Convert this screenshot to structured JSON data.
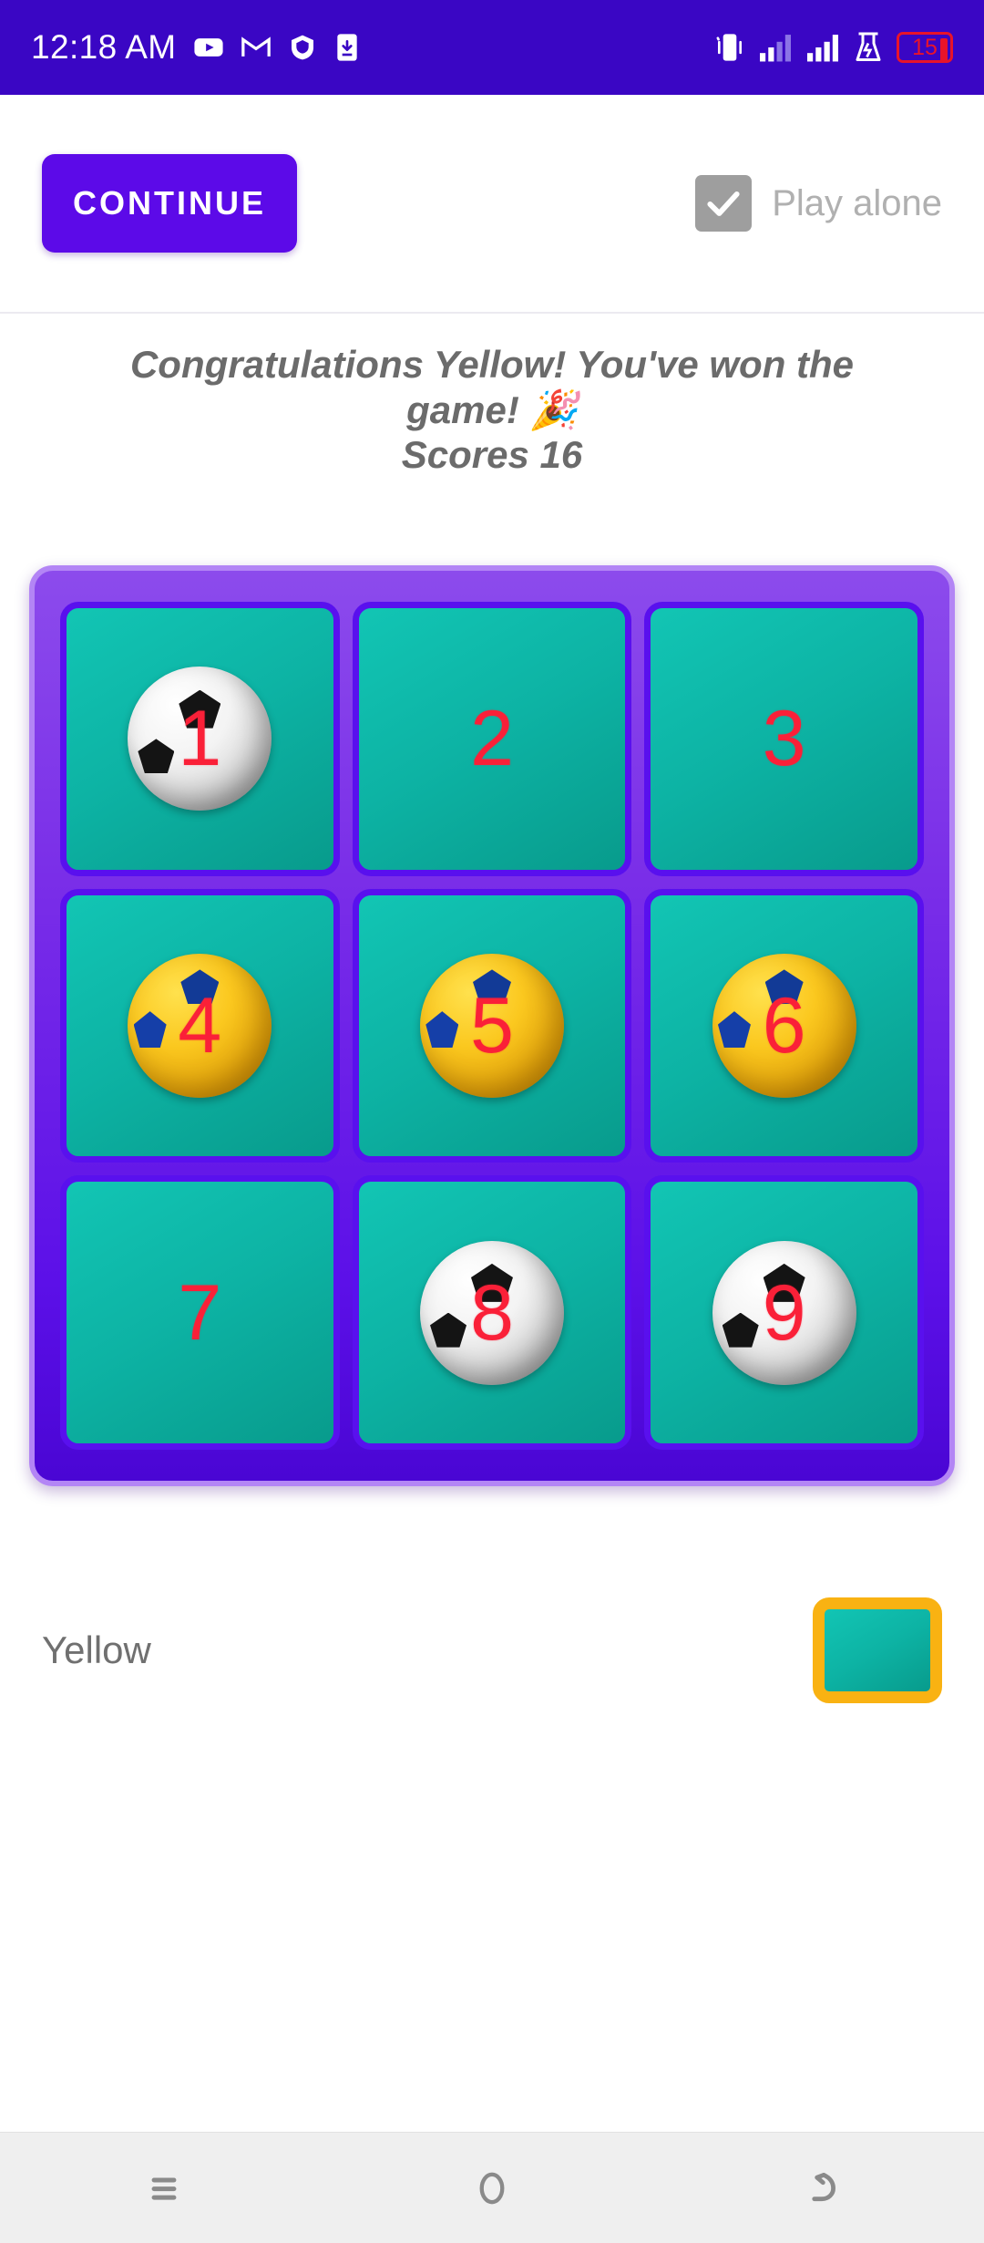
{
  "status_bar": {
    "time": "12:18 AM",
    "background_color": "#3a06c4",
    "left_icons": [
      "youtube-icon",
      "gmail-icon",
      "shield-icon",
      "download-icon"
    ],
    "right_icons": [
      "vibrate-icon",
      "signal-bars-1-icon",
      "signal-bars-2-icon",
      "alarm-flask-icon"
    ],
    "battery_level": "15",
    "battery_color": "#e8142a"
  },
  "toolbar": {
    "continue_label": "CONTINUE",
    "continue_color": "#5c0ae8",
    "play_alone_label": "Play alone",
    "play_alone_checked": true,
    "checkbox_color": "#9e9e9e"
  },
  "message": {
    "line1": "Congratulations Yellow! You've won the game! 🎉",
    "line2": "Scores 16",
    "score": 16,
    "winner": "Yellow",
    "text_color": "#6b6b6b"
  },
  "board": {
    "border_color": "#b385f5",
    "cell_border_color": "#5910ee",
    "cell_fill_color": "#0db3a4",
    "number_color": "#fa2038",
    "cells": [
      {
        "number": "1",
        "mark": "white",
        "icon": "soccer-ball-white-icon"
      },
      {
        "number": "2",
        "mark": "none",
        "icon": ""
      },
      {
        "number": "3",
        "mark": "none",
        "icon": ""
      },
      {
        "number": "4",
        "mark": "yellow",
        "icon": "soccer-ball-yellow-icon"
      },
      {
        "number": "5",
        "mark": "yellow",
        "icon": "soccer-ball-yellow-icon"
      },
      {
        "number": "6",
        "mark": "yellow",
        "icon": "soccer-ball-yellow-icon"
      },
      {
        "number": "7",
        "mark": "none",
        "icon": ""
      },
      {
        "number": "8",
        "mark": "white",
        "icon": "soccer-ball-white-icon"
      },
      {
        "number": "9",
        "mark": "white",
        "icon": "soccer-ball-white-icon"
      }
    ]
  },
  "player": {
    "name": "Yellow",
    "swatch_border_color": "#f9b212",
    "swatch_fill_color": "#0db3a4"
  },
  "navbar": {
    "recents_icon": "menu-icon",
    "home_icon": "circle-icon",
    "back_icon": "back-arrow-icon",
    "background_color": "#efefef"
  }
}
